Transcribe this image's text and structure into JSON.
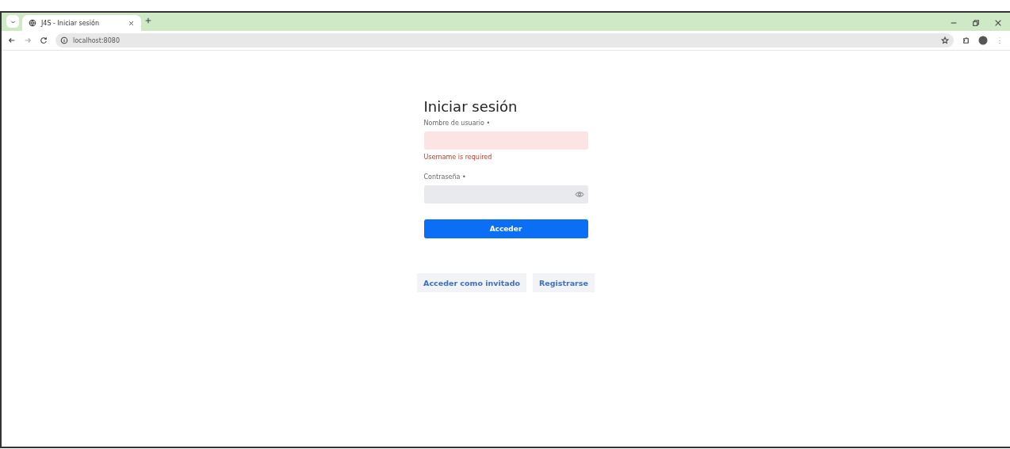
{
  "browser": {
    "tabs": [
      {
        "title": "J4S - Iniciar sesión",
        "selected": true
      }
    ],
    "address": "localhost:8080"
  },
  "form": {
    "title": "Iniciar sesión",
    "fields": [
      {
        "label": "Nombre de usuario •",
        "kind": "text",
        "invalid": true,
        "error": "Username is required"
      },
      {
        "label": "Contraseña •",
        "kind": "password",
        "invalid": false
      }
    ],
    "submit": "Acceder"
  },
  "links": [
    "Acceder como invitado",
    "Registrarse"
  ]
}
